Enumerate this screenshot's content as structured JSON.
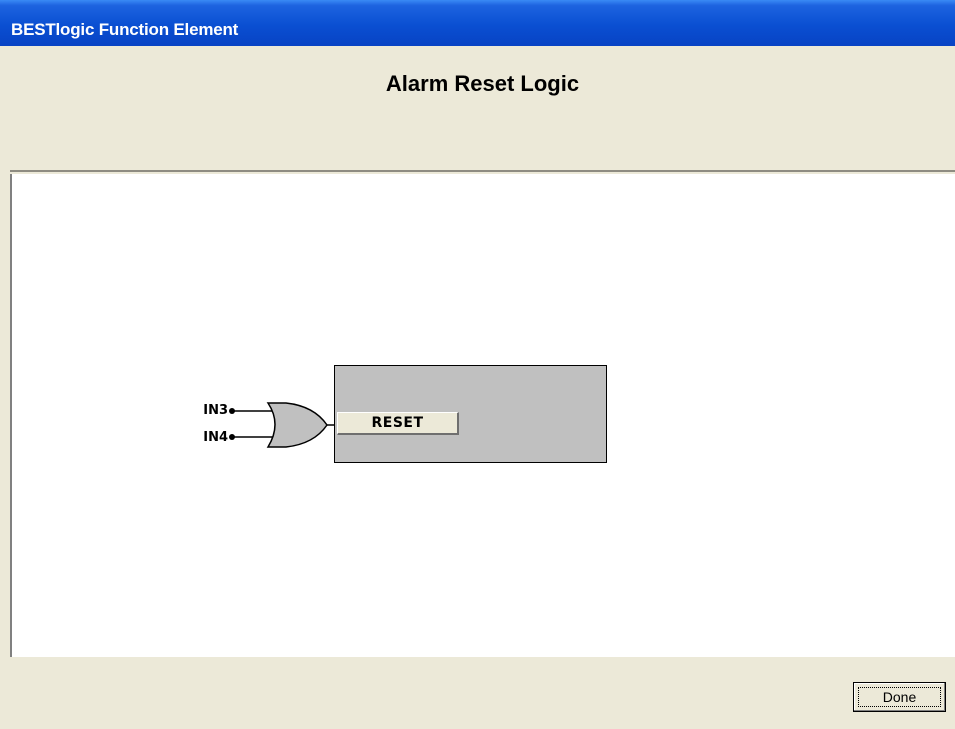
{
  "window": {
    "title": "BESTlogic Function Element"
  },
  "header": {
    "title": "Alarm Reset Logic"
  },
  "diagram": {
    "inputs": [
      "IN3",
      "IN4"
    ],
    "gate_type": "or-gate-icon",
    "block_input_label": "RESET",
    "block_fill": "#c0c0c0"
  },
  "footer": {
    "done_label": "Done"
  },
  "colors": {
    "titlebar": "#0a4fd2",
    "dialog_bg": "#ece9d8",
    "canvas_bg": "#ffffff"
  }
}
